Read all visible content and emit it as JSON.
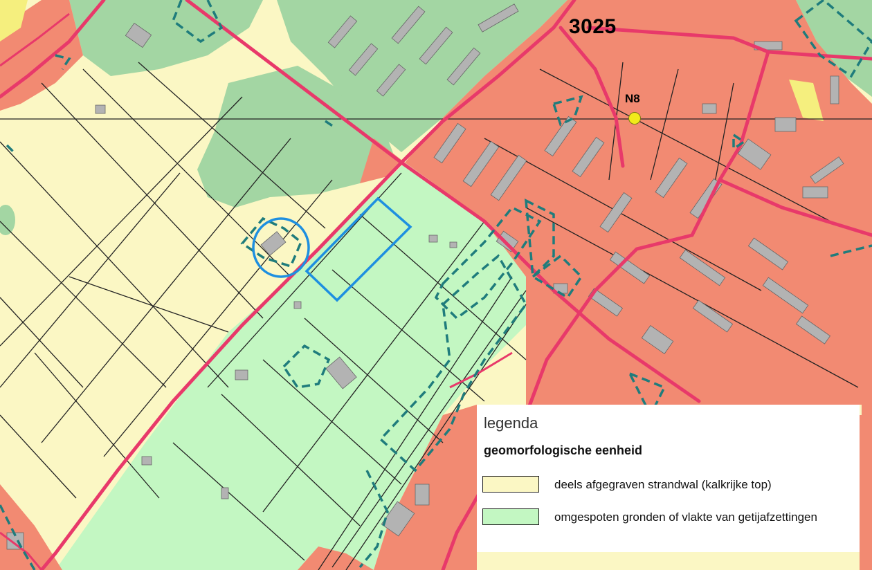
{
  "map": {
    "area_code": "3025",
    "nap_label": "N8",
    "colors": {
      "beach_ridge": "#fbf7c4",
      "tidal_plain": "#c3f7c2",
      "urban": "#f28a72",
      "dune_green": "#a3d6a3",
      "roads": "#e8396a",
      "study_site": "#1e8fe0",
      "monument_outline": "#1f7c7c",
      "buildings": "#b3b3b3",
      "parcel_lines": "#222222"
    },
    "icons": [
      "nap-point-icon"
    ]
  },
  "legend": {
    "title": "legenda",
    "subtitle": "geomorfologische eenheid",
    "items": [
      {
        "label": "deels afgegraven strandwal (kalkrijke top)",
        "color": "#fbf7c4"
      },
      {
        "label": "omgespoten gronden of vlakte van getijafzettingen",
        "color": "#c3f7c2"
      }
    ]
  }
}
